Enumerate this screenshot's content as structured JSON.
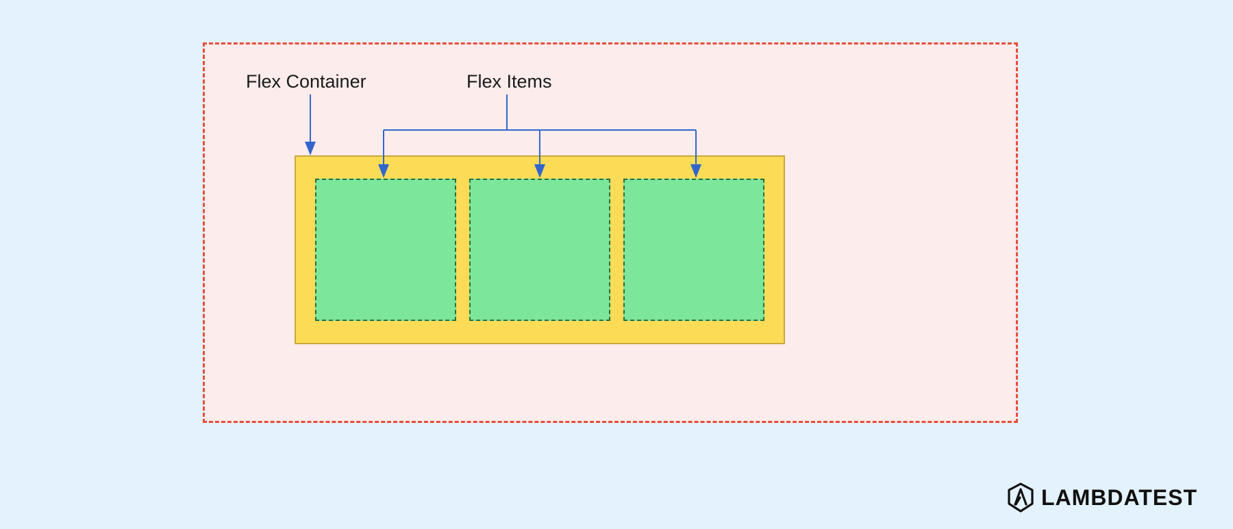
{
  "labels": {
    "container": "Flex Container",
    "items": "Flex Items"
  },
  "diagram": {
    "flex_item_count": 3
  },
  "colors": {
    "page_bg": "#e3f2fd",
    "outer_border": "#e74c3c",
    "outer_fill": "#fdecec",
    "container_fill": "#fcdc57",
    "container_border": "#c9a83e",
    "item_fill": "#7ce79a",
    "item_border": "#2f6b3e",
    "arrow": "#3366cc"
  },
  "brand": {
    "name": "LAMBDATEST"
  }
}
